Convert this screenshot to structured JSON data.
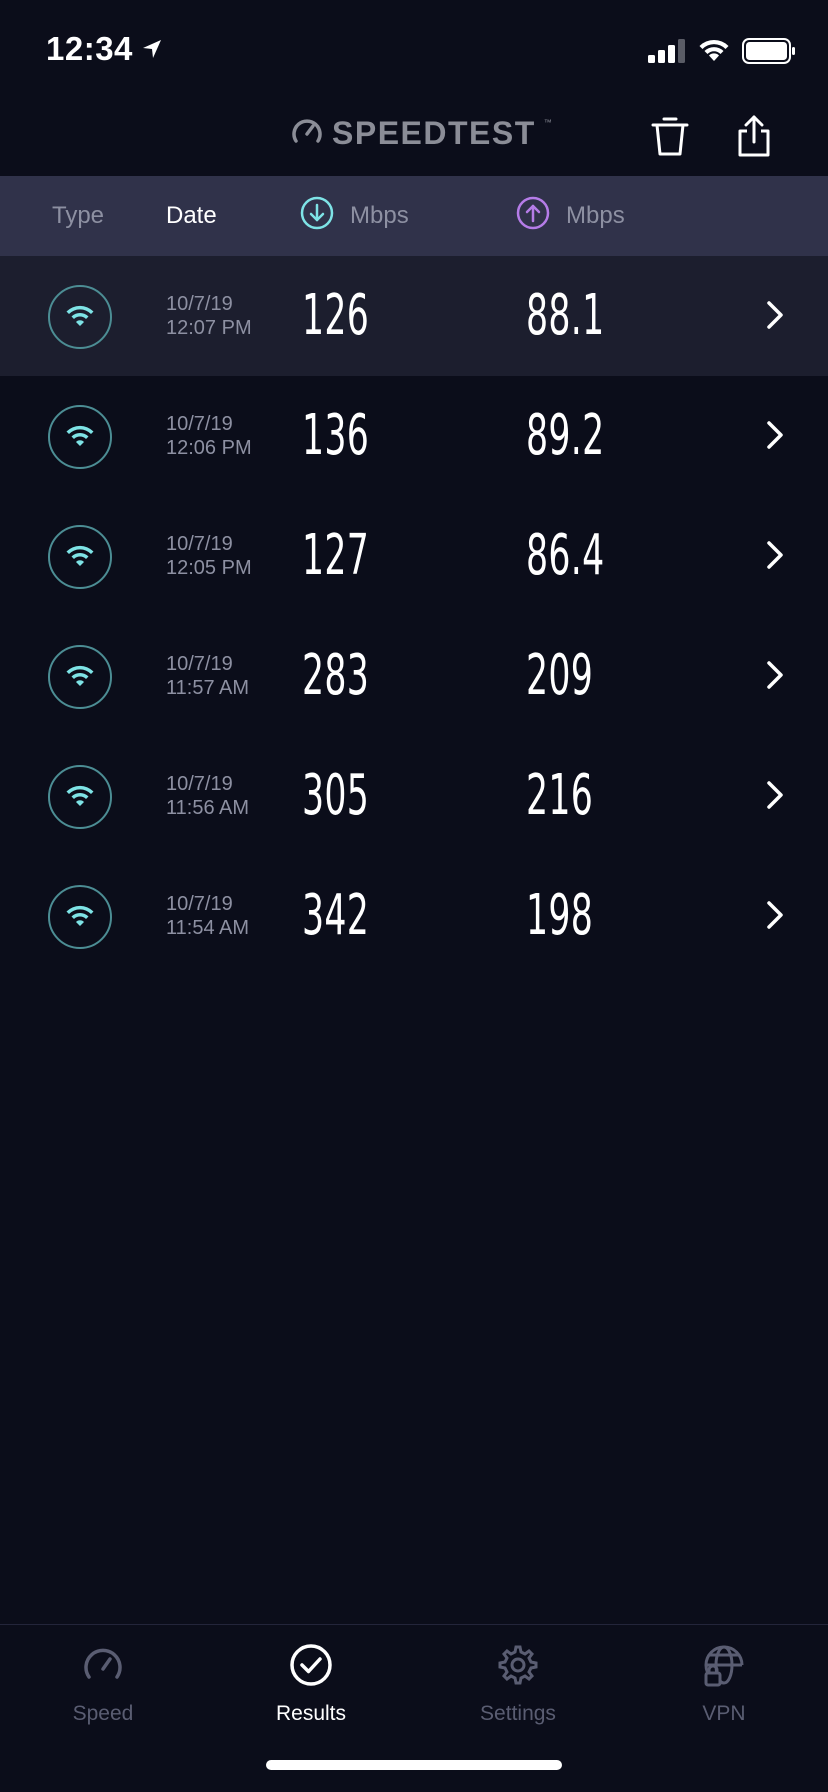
{
  "status_bar": {
    "time": "12:34"
  },
  "header": {
    "brand": "SPEEDTEST",
    "brand_tm": "™",
    "trash_icon": "trash-icon",
    "share_icon": "share-icon"
  },
  "columns": {
    "type": "Type",
    "date": "Date",
    "download": "Mbps",
    "upload": "Mbps"
  },
  "colors": {
    "background": "#0b0d1a",
    "header_bar": "#30324a",
    "selected_row": "#1c1e2e",
    "download_accent": "#7ee3e6",
    "upload_accent": "#b57ce8",
    "wifi_ring": "#4c8d94"
  },
  "results": [
    {
      "date": "10/7/19",
      "time": "12:07 PM",
      "download": "126",
      "upload": "88.1",
      "type": "wifi"
    },
    {
      "date": "10/7/19",
      "time": "12:06 PM",
      "download": "136",
      "upload": "89.2",
      "type": "wifi"
    },
    {
      "date": "10/7/19",
      "time": "12:05 PM",
      "download": "127",
      "upload": "86.4",
      "type": "wifi"
    },
    {
      "date": "10/7/19",
      "time": "11:57 AM",
      "download": "283",
      "upload": "209",
      "type": "wifi"
    },
    {
      "date": "10/7/19",
      "time": "11:56 AM",
      "download": "305",
      "upload": "216",
      "type": "wifi"
    },
    {
      "date": "10/7/19",
      "time": "11:54 AM",
      "download": "342",
      "upload": "198",
      "type": "wifi"
    }
  ],
  "tabs": [
    {
      "label": "Speed",
      "icon": "speedometer-icon"
    },
    {
      "label": "Results",
      "icon": "checkmark-circle-icon",
      "active": true
    },
    {
      "label": "Settings",
      "icon": "gear-icon"
    },
    {
      "label": "VPN",
      "icon": "globe-lock-icon"
    }
  ]
}
